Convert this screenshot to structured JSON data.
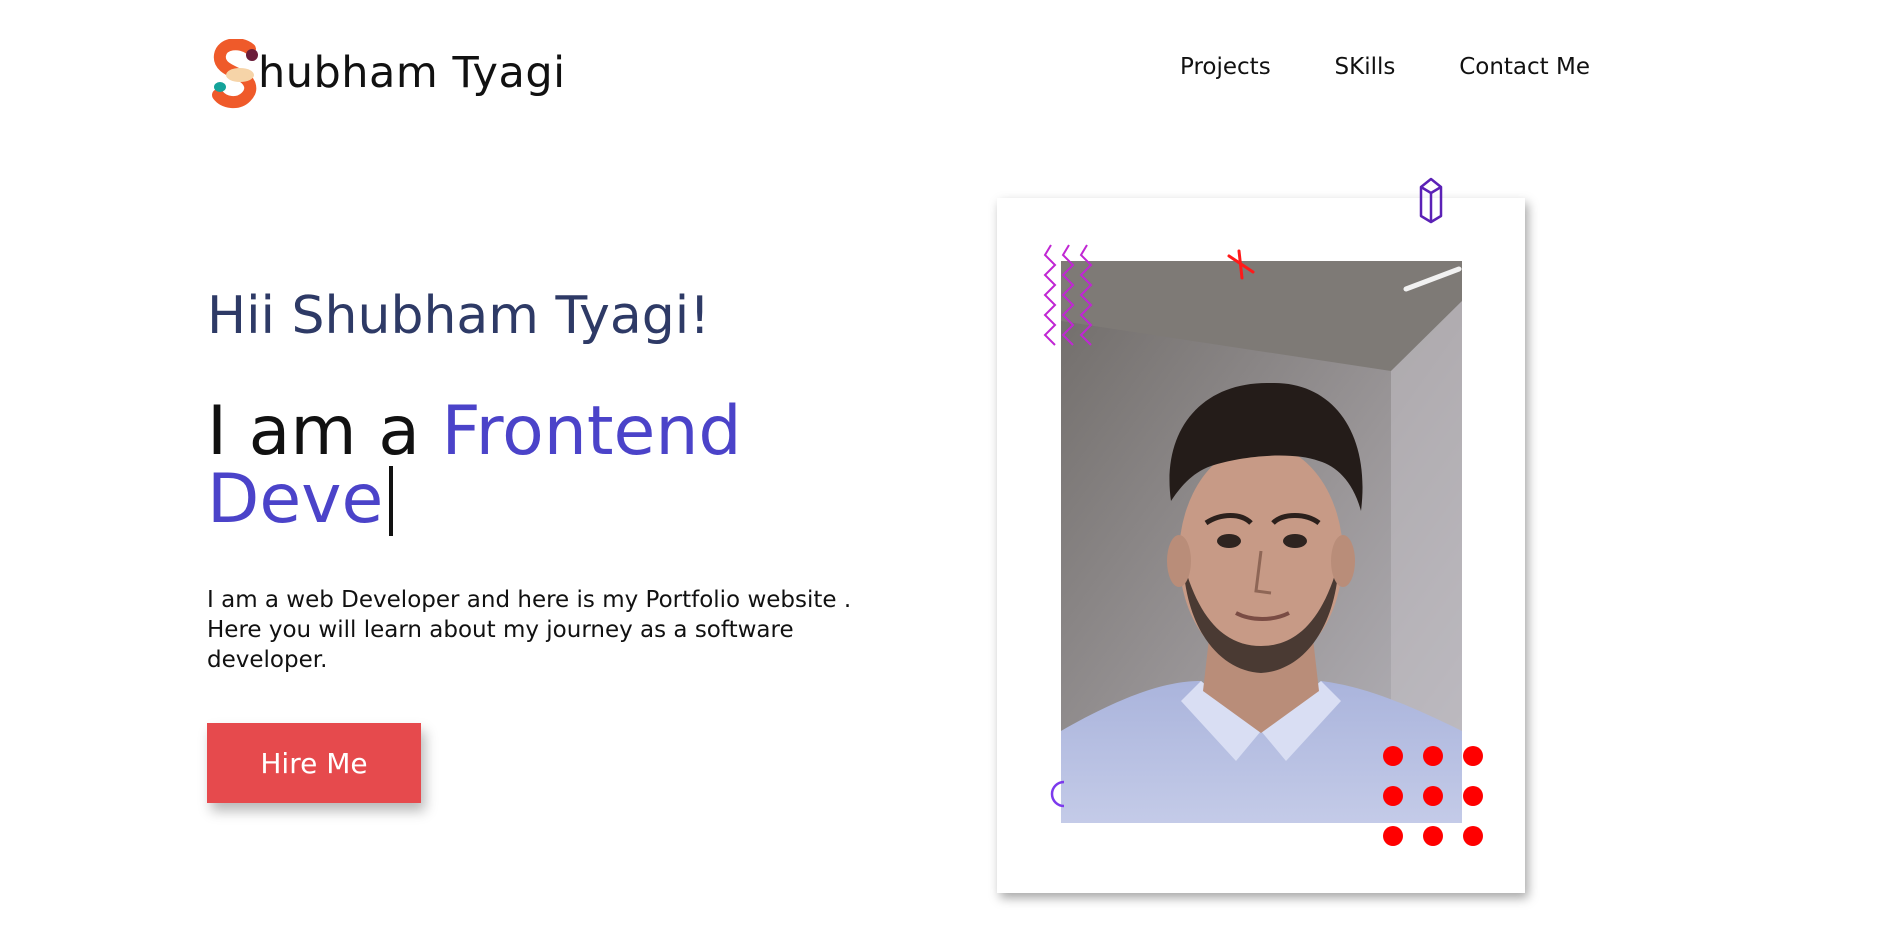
{
  "header": {
    "logo_letter": "S",
    "logo_text": "hubham Tyagi",
    "nav": [
      {
        "label": "Projects"
      },
      {
        "label": "SKills"
      },
      {
        "label": "Contact Me"
      }
    ]
  },
  "hero": {
    "greeting": "Hii Shubham Tyagi!",
    "headline_prefix": "I am a ",
    "headline_accent_1": "Frontend",
    "headline_accent_2": "Deve",
    "description": "I am a web Developer and here is my Portfolio website . Here you will learn about my journey as a software developer.",
    "cta_label": "Hire Me"
  },
  "colors": {
    "accent": "#4b43c9",
    "greeting": "#2e3a66",
    "cta": "#e64a4d",
    "dots": "#ff0000",
    "zigzag": "#c026d3",
    "prism": "#5b21b6"
  },
  "icons": {
    "logo": "s-logo-icon",
    "zigzag": "zigzag-icon",
    "prism": "prism-icon",
    "cross": "cross-icon",
    "dots": "dots-grid-icon",
    "circle": "circle-icon"
  }
}
